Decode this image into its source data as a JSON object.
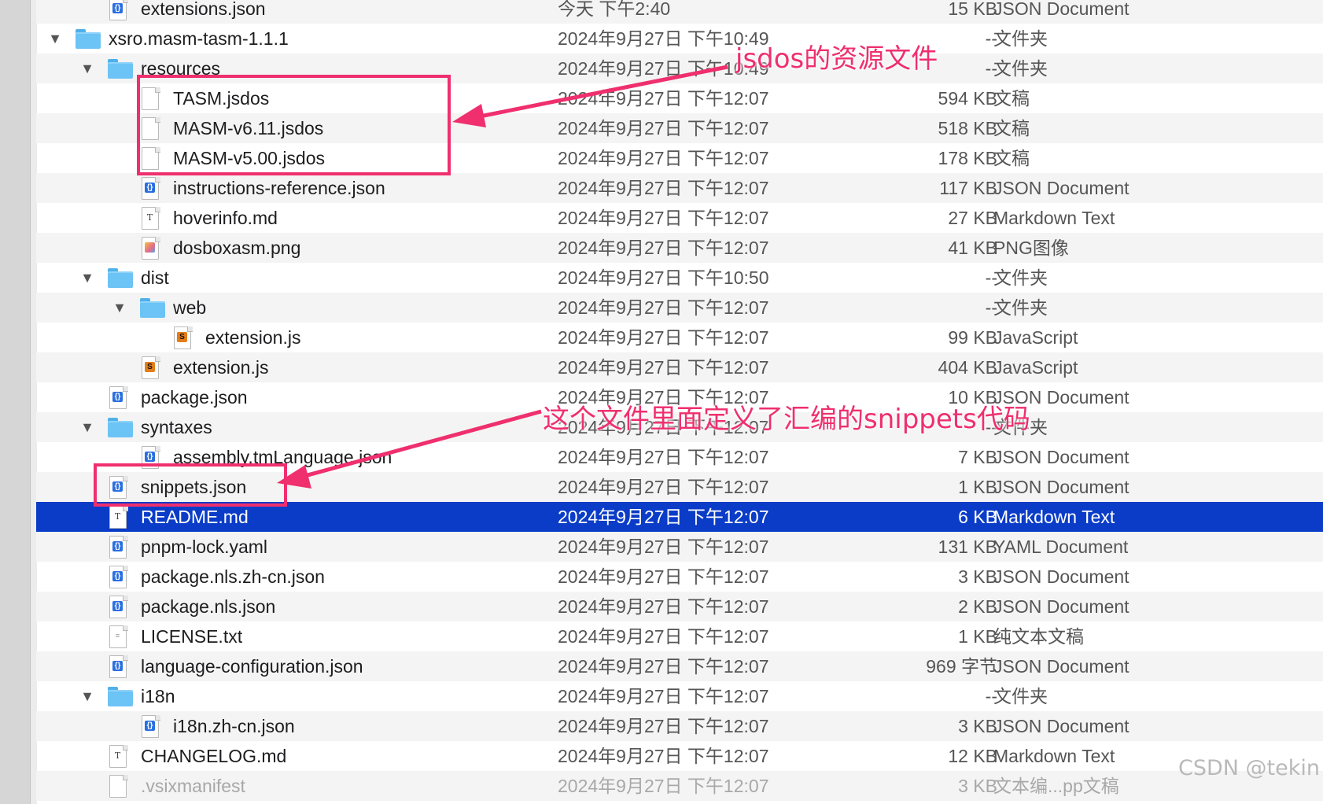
{
  "rows": [
    {
      "name": "extensions.json",
      "date": "今天 下午2:40",
      "size": "15 KB",
      "kind": "JSON Document",
      "icon": "json-file-icon",
      "depth": 1,
      "expand": ""
    },
    {
      "name": "xsro.masm-tasm-1.1.1",
      "date": "2024年9月27日 下午10:49",
      "size": "--",
      "kind": "文件夹",
      "icon": "folder-icon",
      "depth": 0,
      "expand": "▼"
    },
    {
      "name": "resources",
      "date": "2024年9月27日 下午10:49",
      "size": "--",
      "kind": "文件夹",
      "icon": "folder-icon",
      "depth": 1,
      "expand": "▼"
    },
    {
      "name": "TASM.jsdos",
      "date": "2024年9月27日 下午12:07",
      "size": "594 KB",
      "kind": "文稿",
      "icon": "document-icon",
      "depth": 2,
      "expand": ""
    },
    {
      "name": "MASM-v6.11.jsdos",
      "date": "2024年9月27日 下午12:07",
      "size": "518 KB",
      "kind": "文稿",
      "icon": "document-icon",
      "depth": 2,
      "expand": ""
    },
    {
      "name": "MASM-v5.00.jsdos",
      "date": "2024年9月27日 下午12:07",
      "size": "178 KB",
      "kind": "文稿",
      "icon": "document-icon",
      "depth": 2,
      "expand": ""
    },
    {
      "name": "instructions-reference.json",
      "date": "2024年9月27日 下午12:07",
      "size": "117 KB",
      "kind": "JSON Document",
      "icon": "json-file-icon",
      "depth": 2,
      "expand": ""
    },
    {
      "name": "hoverinfo.md",
      "date": "2024年9月27日 下午12:07",
      "size": "27 KB",
      "kind": "Markdown Text",
      "icon": "markdown-file-icon",
      "depth": 2,
      "expand": ""
    },
    {
      "name": "dosboxasm.png",
      "date": "2024年9月27日 下午12:07",
      "size": "41 KB",
      "kind": "PNG图像",
      "icon": "png-file-icon",
      "depth": 2,
      "expand": ""
    },
    {
      "name": "dist",
      "date": "2024年9月27日 下午10:50",
      "size": "--",
      "kind": "文件夹",
      "icon": "folder-icon",
      "depth": 1,
      "expand": "▼"
    },
    {
      "name": "web",
      "date": "2024年9月27日 下午12:07",
      "size": "--",
      "kind": "文件夹",
      "icon": "folder-icon",
      "depth": 2,
      "expand": "▼"
    },
    {
      "name": "extension.js",
      "date": "2024年9月27日 下午12:07",
      "size": "99 KB",
      "kind": "JavaScript",
      "icon": "javascript-file-icon",
      "depth": 3,
      "expand": ""
    },
    {
      "name": "extension.js",
      "date": "2024年9月27日 下午12:07",
      "size": "404 KB",
      "kind": "JavaScript",
      "icon": "javascript-file-icon",
      "depth": 2,
      "expand": ""
    },
    {
      "name": "package.json",
      "date": "2024年9月27日 下午12:07",
      "size": "10 KB",
      "kind": "JSON Document",
      "icon": "json-file-icon",
      "depth": 1,
      "expand": ""
    },
    {
      "name": "syntaxes",
      "date": "2024年9月27日 下午12:07",
      "size": "--",
      "kind": "文件夹",
      "icon": "folder-icon",
      "depth": 1,
      "expand": "▼"
    },
    {
      "name": "assembly.tmLanguage.json",
      "date": "2024年9月27日 下午12:07",
      "size": "7 KB",
      "kind": "JSON Document",
      "icon": "json-file-icon",
      "depth": 2,
      "expand": ""
    },
    {
      "name": "snippets.json",
      "date": "2024年9月27日 下午12:07",
      "size": "1 KB",
      "kind": "JSON Document",
      "icon": "json-file-icon",
      "depth": 1,
      "expand": ""
    },
    {
      "name": "README.md",
      "date": "2024年9月27日 下午12:07",
      "size": "6 KB",
      "kind": "Markdown Text",
      "icon": "markdown-file-icon",
      "depth": 1,
      "expand": "",
      "selected": true
    },
    {
      "name": "pnpm-lock.yaml",
      "date": "2024年9月27日 下午12:07",
      "size": "131 KB",
      "kind": "YAML Document",
      "icon": "json-file-icon",
      "depth": 1,
      "expand": ""
    },
    {
      "name": "package.nls.zh-cn.json",
      "date": "2024年9月27日 下午12:07",
      "size": "3 KB",
      "kind": "JSON Document",
      "icon": "json-file-icon",
      "depth": 1,
      "expand": ""
    },
    {
      "name": "package.nls.json",
      "date": "2024年9月27日 下午12:07",
      "size": "2 KB",
      "kind": "JSON Document",
      "icon": "json-file-icon",
      "depth": 1,
      "expand": ""
    },
    {
      "name": "LICENSE.txt",
      "date": "2024年9月27日 下午12:07",
      "size": "1 KB",
      "kind": "纯文本文稿",
      "icon": "text-file-icon",
      "depth": 1,
      "expand": ""
    },
    {
      "name": "language-configuration.json",
      "date": "2024年9月27日 下午12:07",
      "size": "969 字节",
      "kind": "JSON Document",
      "icon": "json-file-icon",
      "depth": 1,
      "expand": ""
    },
    {
      "name": "i18n",
      "date": "2024年9月27日 下午12:07",
      "size": "--",
      "kind": "文件夹",
      "icon": "folder-icon",
      "depth": 1,
      "expand": "▼"
    },
    {
      "name": "i18n.zh-cn.json",
      "date": "2024年9月27日 下午12:07",
      "size": "3 KB",
      "kind": "JSON Document",
      "icon": "json-file-icon",
      "depth": 2,
      "expand": ""
    },
    {
      "name": "CHANGELOG.md",
      "date": "2024年9月27日 下午12:07",
      "size": "12 KB",
      "kind": "Markdown Text",
      "icon": "markdown-file-icon",
      "depth": 1,
      "expand": ""
    },
    {
      "name": ".vsixmanifest",
      "date": "2024年9月27日 下午12:07",
      "size": "3 KB",
      "kind": "文本编...pp文稿",
      "icon": "document-icon",
      "depth": 1,
      "expand": "",
      "dim": true
    }
  ],
  "annotations": {
    "jsdos_note": "jsdos的资源文件",
    "snippets_note": "这个文件里面定义了汇编的snippets代码"
  },
  "watermark": "CSDN @tekin",
  "colors": {
    "selection": "#0a3cc8",
    "annotation": "#ef2f6e",
    "folder": "#6cc3f5"
  }
}
